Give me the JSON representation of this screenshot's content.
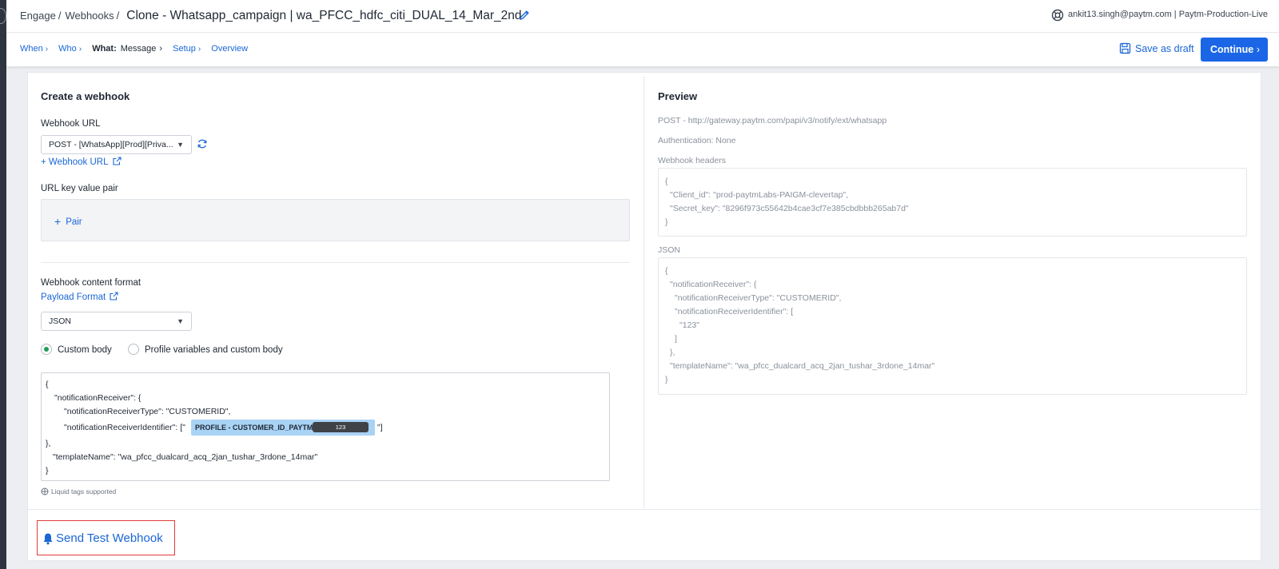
{
  "breadcrumb": {
    "items": [
      "Engage",
      "Webhooks"
    ],
    "title": "Clone - Whatsapp_campaign | wa_PFCC_hdfc_citi_DUAL_14_Mar_2nd"
  },
  "account": {
    "text": "ankit13.singh@paytm.com | Paytm-Production-Live"
  },
  "steps": {
    "when": "When",
    "who": "Who",
    "current_key": "What:",
    "current_value": "Message",
    "setup": "Setup",
    "overview": "Overview"
  },
  "actions": {
    "save_draft": "Save as draft",
    "continue": "Continue"
  },
  "create": {
    "heading": "Create a webhook",
    "webhook_url_label": "Webhook URL",
    "webhook_url_value": "POST - [WhatsApp][Prod][Priva...",
    "add_webhook_url": "+ Webhook URL",
    "url_kv_label": "URL key value pair",
    "add_pair": "Pair",
    "content_format_label": "Webhook content format",
    "payload_format_link": "Payload Format",
    "format_value": "JSON",
    "radio_custom": "Custom body",
    "radio_profile": "Profile variables and custom body",
    "body_lines": [
      "{",
      "\"notificationReceiver\": {",
      "\"notificationReceiverType\": \"CUSTOMERID\",",
      "\"notificationReceiverIdentifier\": [\"",
      "\"]",
      "},",
      "\"templateName\": \"wa_pfcc_dualcard_acq_2jan_tushar_3rdone_14mar\"",
      "}"
    ],
    "tag_label": "PROFILE - CUSTOMER_ID_PAYTM",
    "tag_value": "123",
    "liquid_note": "Liquid tags supported"
  },
  "preview": {
    "heading": "Preview",
    "endpoint": "POST - http://gateway.paytm.com/papi/v3/notify/ext/whatsapp",
    "auth": "Authentication: None",
    "headers_label": "Webhook headers",
    "headers_lines": [
      "{",
      "\"Client_id\": \"prod-paytmLabs-PAIGM-clevertap\",",
      "\"Secret_key\": \"8296f973c55642b4cae3cf7e385cbdbbb265ab7d\"",
      "}"
    ],
    "json_label": "JSON",
    "json_lines": [
      "{",
      "\"notificationReceiver\": {",
      "\"notificationReceiverType\": \"CUSTOMERID\",",
      "\"notificationReceiverIdentifier\": [",
      "\"123\"",
      "]",
      "},",
      "\"templateName\": \"wa_pfcc_dualcard_acq_2jan_tushar_3rdone_14mar\"",
      "}"
    ]
  },
  "send_test": {
    "label": "Send Test Webhook"
  },
  "colors": {
    "accent": "#1a66e6",
    "link": "#1a66d6",
    "highlight_border": "#e03a3a",
    "tag_bg": "#a9d3f5",
    "radio_on": "#1f9d57"
  }
}
